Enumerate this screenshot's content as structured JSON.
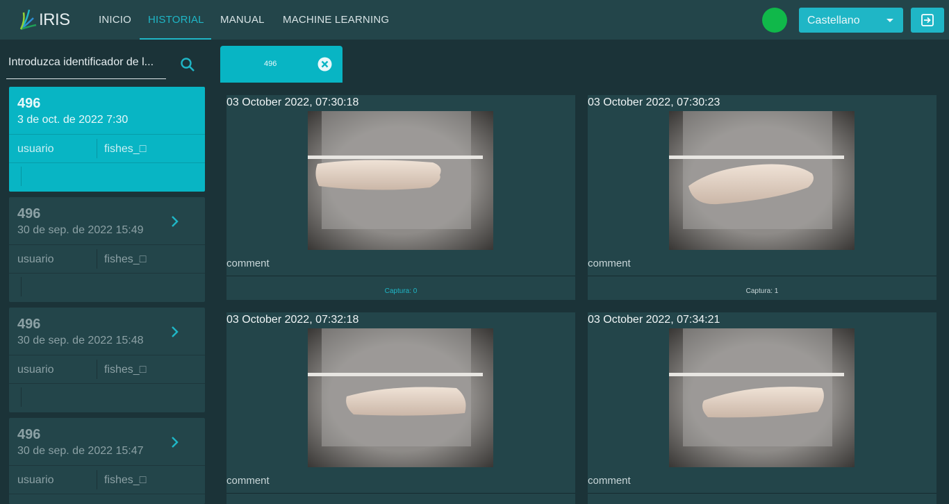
{
  "app": {
    "logo_text": "IRIS"
  },
  "nav": {
    "items": [
      {
        "label": "INICIO",
        "active": false
      },
      {
        "label": "HISTORIAL",
        "active": true
      },
      {
        "label": "MANUAL",
        "active": false
      },
      {
        "label": "MACHINE LEARNING",
        "active": false
      }
    ]
  },
  "header": {
    "status_color": "#10b84a",
    "language": "Castellano",
    "logout_icon": "logout-icon"
  },
  "sidebar": {
    "search_placeholder": "Introduzca identificador de l...",
    "items": [
      {
        "id": "496",
        "date": "3 de oct. de 2022 7:30",
        "user": "usuario",
        "model": "fishes_□",
        "active": true
      },
      {
        "id": "496",
        "date": "30 de sep. de 2022 15:49",
        "user": "usuario",
        "model": "fishes_□",
        "active": false
      },
      {
        "id": "496",
        "date": "30 de sep. de 2022 15:48",
        "user": "usuario",
        "model": "fishes_□",
        "active": false
      },
      {
        "id": "496",
        "date": "30 de sep. de 2022 15:47",
        "user": "usuario",
        "model": "fishes_□",
        "active": false
      }
    ]
  },
  "tabs": [
    {
      "label": "496"
    }
  ],
  "captures": [
    {
      "timestamp": "03 October 2022, 07:30:18",
      "comment": "comment",
      "caption": "Captura: 0",
      "selected": true
    },
    {
      "timestamp": "03 October 2022, 07:30:23",
      "comment": "comment",
      "caption": "Captura: 1",
      "selected": false
    },
    {
      "timestamp": "03 October 2022, 07:32:18",
      "comment": "comment",
      "caption": "",
      "selected": false
    },
    {
      "timestamp": "03 October 2022, 07:34:21",
      "comment": "comment",
      "caption": "",
      "selected": false
    }
  ],
  "colors": {
    "accent": "#08b5c4",
    "background": "#1b3338",
    "surface": "#23454a"
  }
}
